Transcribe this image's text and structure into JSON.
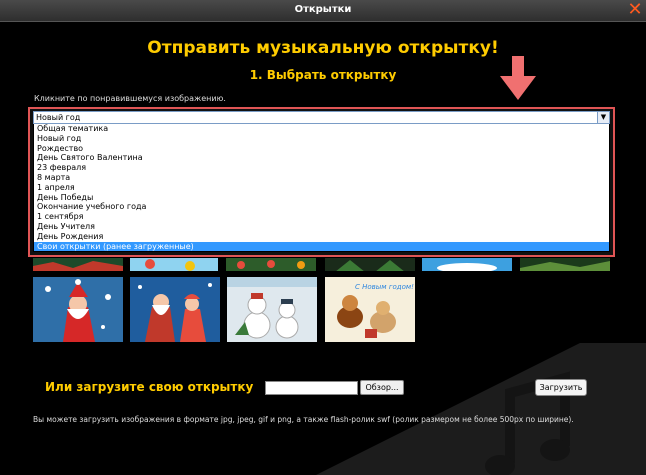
{
  "window": {
    "title": "Открытки"
  },
  "header": {
    "main_title": "Отправить музыкальную открытку!",
    "step_title": "1. Выбрать открытку",
    "hint": "Кликните по понравившемуся изображению."
  },
  "category_select": {
    "selected": "Новый год",
    "options": [
      "Общая тематика",
      "Новый год",
      "Рождество",
      "День Святого Валентина",
      "23 февраля",
      "8 марта",
      "1 апреля",
      "День Победы",
      "Окончание учебного года",
      "1 сентября",
      "День Учителя",
      "День Рождения",
      "Свои открытки (ранее загруженные)"
    ],
    "highlighted_option": "Свои открытки (ранее загруженные)"
  },
  "cards": [
    {
      "icon": "santa-postcard"
    },
    {
      "icon": "ded-moroz-snegurochka-postcard"
    },
    {
      "icon": "snowmen-postcard"
    },
    {
      "icon": "new-year-dogs-postcard"
    },
    {
      "icon": "new-year-puppies-postcard"
    }
  ],
  "upload": {
    "label": "Или загрузите свою открытку",
    "browse_label": "Обзор...",
    "submit_label": "Загрузить",
    "file_value": "",
    "note": "Вы можете загрузить изображения в формате jpg, jpeg, gif и png, а также flash-ролик swf (ролик размером не более 500px по ширине)."
  },
  "colors": {
    "accent": "#ffcc00",
    "close": "#ff5a1f",
    "highlight_border": "#e05555",
    "arrow": "#f07070"
  }
}
